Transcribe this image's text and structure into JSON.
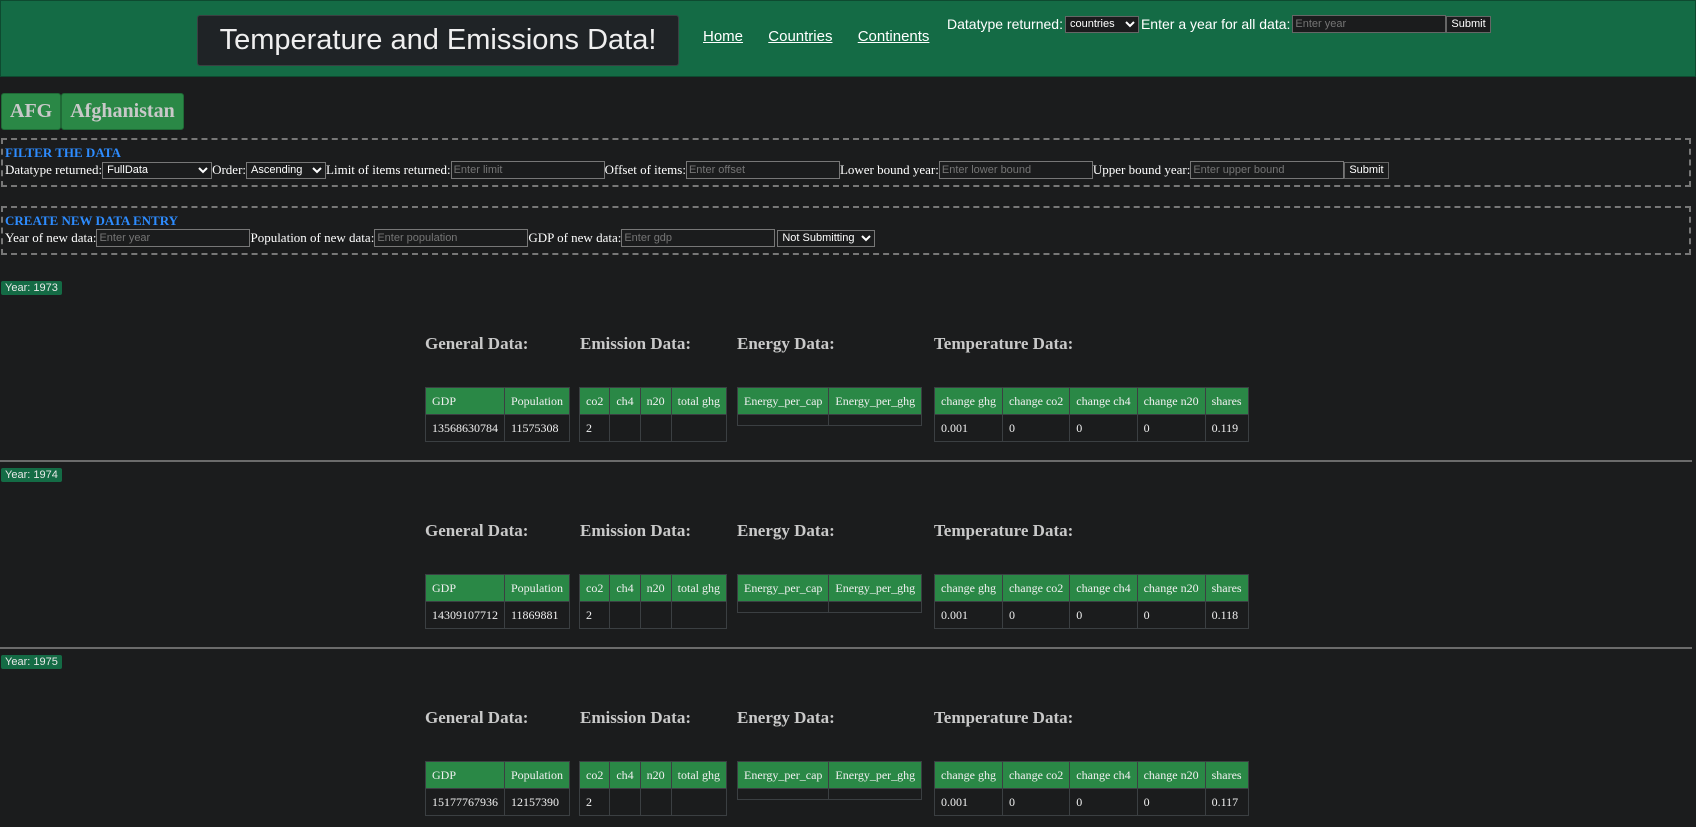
{
  "header": {
    "title": "Temperature and Emissions Data!",
    "nav": [
      "Home",
      "Countries",
      "Continents"
    ],
    "datatype_label": "Datatype returned:",
    "datatype_value": "countries",
    "year_label": "Enter a year for all data:",
    "year_placeholder": "Enter year",
    "submit": "Submit"
  },
  "country": {
    "code": "AFG",
    "name": "Afghanistan"
  },
  "filter": {
    "title": "FILTER THE DATA",
    "datatype_label": "Datatype returned:",
    "datatype_value": "FullData",
    "order_label": "Order:",
    "order_value": "Ascending",
    "limit_label": "Limit of items returned:",
    "limit_placeholder": "Enter limit",
    "offset_label": "Offset of items:",
    "offset_placeholder": "Enter offset",
    "lower_label": "Lower bound year:",
    "lower_placeholder": "Enter lower bound",
    "upper_label": "Upper bound year:",
    "upper_placeholder": "Enter upper bound",
    "submit": "Submit"
  },
  "create": {
    "title": "CREATE NEW DATA ENTRY",
    "year_label": "Year of new data:",
    "year_placeholder": "Enter year",
    "pop_label": "Population of new data:",
    "pop_placeholder": "Enter population",
    "gdp_label": "GDP of new data:",
    "gdp_placeholder": "Enter gdp",
    "mode_value": "Not Submitting"
  },
  "sections": {
    "general": "General Data:",
    "emission": "Emission Data:",
    "energy": "Energy Data:",
    "temperature": "Temperature Data:"
  },
  "columns": {
    "general": [
      "GDP",
      "Population"
    ],
    "emission": [
      "co2",
      "ch4",
      "n20",
      "total ghg"
    ],
    "energy": [
      "Energy_per_cap",
      "Energy_per_ghg"
    ],
    "temperature": [
      "change ghg",
      "change co2",
      "change ch4",
      "change n20",
      "shares"
    ]
  },
  "years": [
    {
      "label": "Year: 1973",
      "general": [
        "13568630784",
        "11575308"
      ],
      "emission": [
        "2",
        "",
        "",
        ""
      ],
      "temperature": [
        "0.001",
        "0",
        "0",
        "0",
        "0.119"
      ]
    },
    {
      "label": "Year: 1974",
      "general": [
        "14309107712",
        "11869881"
      ],
      "emission": [
        "2",
        "",
        "",
        ""
      ],
      "temperature": [
        "0.001",
        "0",
        "0",
        "0",
        "0.118"
      ]
    },
    {
      "label": "Year: 1975",
      "general": [
        "15177767936",
        "12157390"
      ],
      "emission": [
        "2",
        "",
        "",
        ""
      ],
      "temperature": [
        "0.001",
        "0",
        "0",
        "0",
        "0.117"
      ]
    }
  ]
}
